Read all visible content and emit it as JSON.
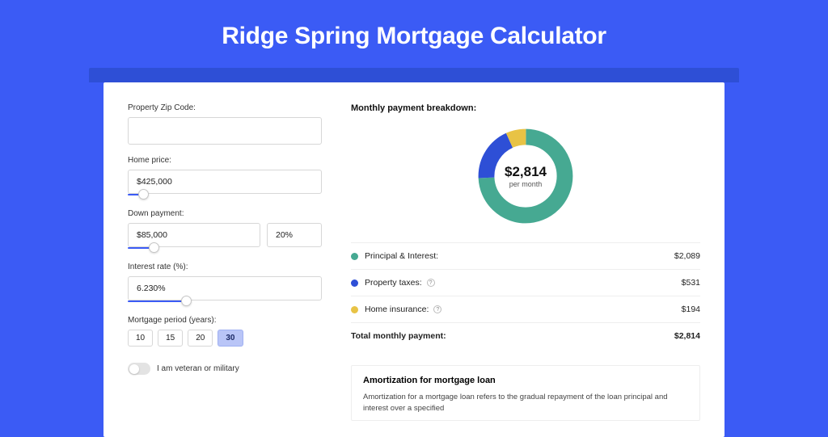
{
  "title": "Ridge Spring Mortgage Calculator",
  "form": {
    "zip_label": "Property Zip Code:",
    "zip_value": "",
    "home_price_label": "Home price:",
    "home_price_value": "$425,000",
    "home_price_slider_pct": 8,
    "down_label": "Down payment:",
    "down_value": "$85,000",
    "down_pct_value": "20%",
    "down_slider_pct": 20,
    "rate_label": "Interest rate (%):",
    "rate_value": "6.230%",
    "rate_slider_pct": 30,
    "period_label": "Mortgage period (years):",
    "periods": [
      "10",
      "15",
      "20",
      "30"
    ],
    "period_selected": "30",
    "veteran_label": "I am veteran or military",
    "veteran_on": false
  },
  "breakdown": {
    "title": "Monthly payment breakdown:",
    "center_amount": "$2,814",
    "center_sub": "per month",
    "items": [
      {
        "label": "Principal & Interest:",
        "value": "$2,089",
        "color": "#46A992",
        "numeric": 2089
      },
      {
        "label": "Property taxes:",
        "value": "$531",
        "color": "#2E4FD6",
        "help": true,
        "numeric": 531
      },
      {
        "label": "Home insurance:",
        "value": "$194",
        "color": "#E8C345",
        "help": true,
        "numeric": 194
      }
    ],
    "total_label": "Total monthly payment:",
    "total_value": "$2,814",
    "total_numeric": 2814
  },
  "amort": {
    "title": "Amortization for mortgage loan",
    "text": "Amortization for a mortgage loan refers to the gradual repayment of the loan principal and interest over a specified"
  },
  "chart_data": {
    "type": "pie",
    "title": "Monthly payment breakdown",
    "categories": [
      "Principal & Interest",
      "Property taxes",
      "Home insurance"
    ],
    "values": [
      2089,
      531,
      194
    ],
    "colors": [
      "#46A992",
      "#2E4FD6",
      "#E8C345"
    ],
    "total": 2814,
    "center_label": "$2,814 per month"
  }
}
